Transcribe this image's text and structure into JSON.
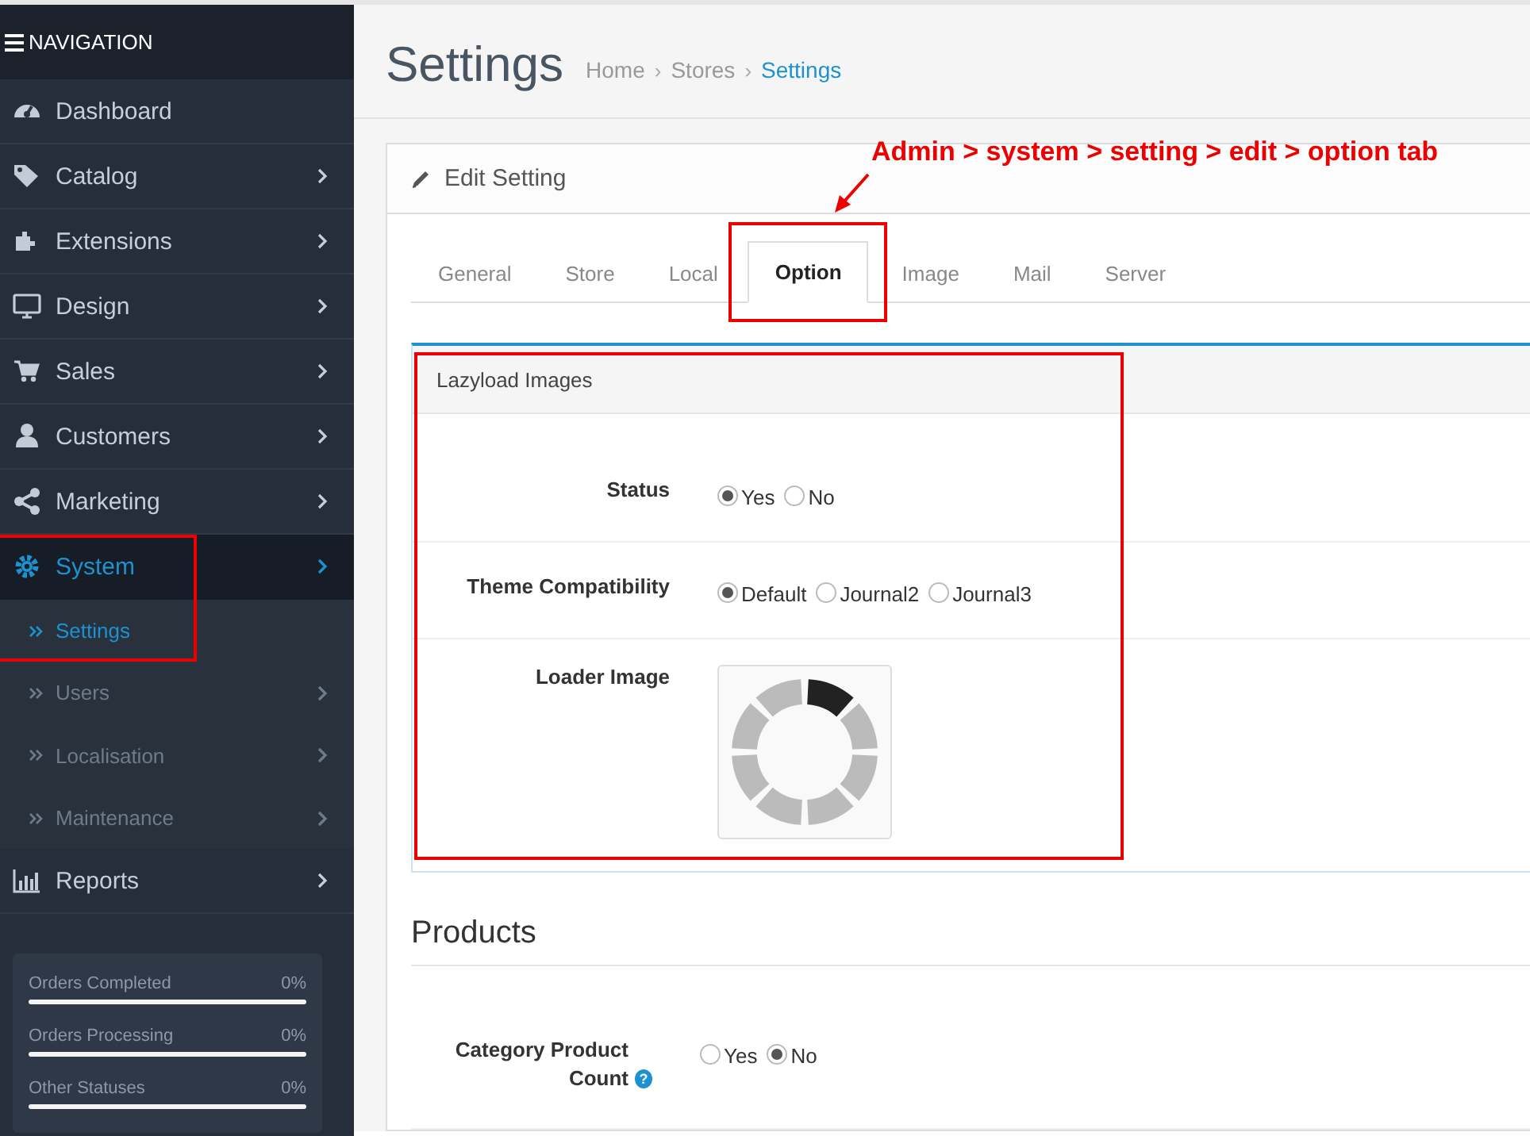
{
  "sidebar": {
    "header": "NAVIGATION",
    "items": [
      {
        "label": "Dashboard",
        "has_children": false,
        "selected": false
      },
      {
        "label": "Catalog",
        "has_children": true,
        "selected": false
      },
      {
        "label": "Extensions",
        "has_children": true,
        "selected": false
      },
      {
        "label": "Design",
        "has_children": true,
        "selected": false
      },
      {
        "label": "Sales",
        "has_children": true,
        "selected": false
      },
      {
        "label": "Customers",
        "has_children": true,
        "selected": false
      },
      {
        "label": "Marketing",
        "has_children": true,
        "selected": false
      },
      {
        "label": "System",
        "has_children": true,
        "selected": true,
        "expanded": true,
        "highlighted": true,
        "children": [
          {
            "label": "Settings",
            "has_children": false,
            "selected": true,
            "highlighted": true
          },
          {
            "label": "Users",
            "has_children": true,
            "selected": false,
            "highlighted": false
          },
          {
            "label": "Localisation",
            "has_children": true,
            "selected": false,
            "highlighted": false
          },
          {
            "label": "Maintenance",
            "has_children": true,
            "selected": false,
            "highlighted": false
          }
        ]
      },
      {
        "label": "Reports",
        "has_children": true,
        "selected": false
      }
    ],
    "stats": [
      {
        "label": "Orders Completed",
        "value": "0%",
        "level": 0
      },
      {
        "label": "Orders Processing",
        "value": "0%",
        "level": 0
      },
      {
        "label": "Other Statuses",
        "value": "0%",
        "level": 0
      }
    ]
  },
  "page": {
    "title": "Settings",
    "separator": "›",
    "breadcrumb": [
      {
        "label": "Home",
        "current": false
      },
      {
        "label": "Stores",
        "current": false
      },
      {
        "label": "Settings",
        "current": true
      }
    ]
  },
  "panel": {
    "heading": "Edit Setting",
    "tabs": [
      {
        "label": "General",
        "selected": false,
        "highlighted": false
      },
      {
        "label": "Store",
        "selected": false,
        "highlighted": false
      },
      {
        "label": "Local",
        "selected": false,
        "highlighted": false
      },
      {
        "label": "Option",
        "selected": true,
        "highlighted": true
      },
      {
        "label": "Image",
        "selected": false,
        "highlighted": false
      },
      {
        "label": "Mail",
        "selected": false,
        "highlighted": false
      },
      {
        "label": "Server",
        "selected": false,
        "highlighted": false
      }
    ],
    "lazyload": {
      "title": "Lazyload Images",
      "highlighted": true,
      "fields": [
        {
          "label": "Status",
          "kind": "radio",
          "options": [
            {
              "label": "Yes",
              "selected": true
            },
            {
              "label": "No",
              "selected": false
            }
          ]
        },
        {
          "label": "Theme Compatibility",
          "kind": "radio",
          "options": [
            {
              "label": "Default",
              "selected": true
            },
            {
              "label": "Journal2",
              "selected": false
            },
            {
              "label": "Journal3",
              "selected": false
            }
          ]
        },
        {
          "label": "Loader Image",
          "kind": "image"
        }
      ]
    },
    "products": {
      "title": "Products",
      "fields": [
        {
          "label": "Category Product Count",
          "help": "?",
          "kind": "radio",
          "options": [
            {
              "label": "Yes",
              "selected": false
            },
            {
              "label": "No",
              "selected": true
            }
          ]
        }
      ]
    }
  },
  "annotation": {
    "text": "Admin > system > setting > edit > option tab"
  }
}
